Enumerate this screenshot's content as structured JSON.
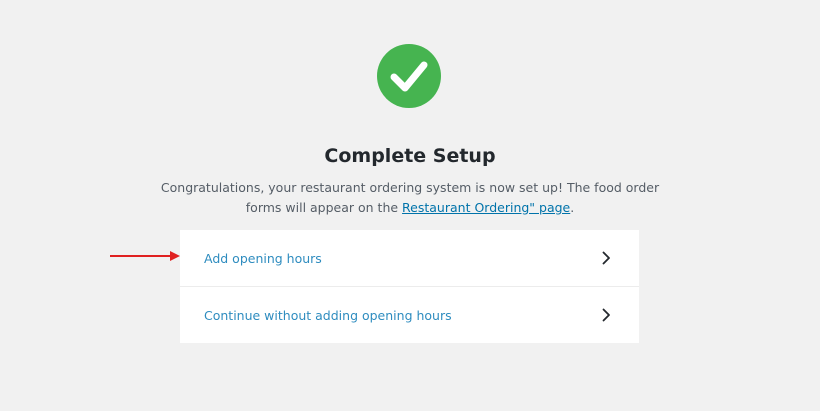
{
  "icons": {
    "success": "check-circle-icon",
    "option_arrow": "chevron-right-icon",
    "pointer": "red-arrow-icon"
  },
  "colors": {
    "success_green": "#46b450",
    "link_blue": "#2e8cbf",
    "annotation_red": "#e02020"
  },
  "setup": {
    "title": "Complete Setup",
    "description_prefix": "Congratulations, your restaurant ordering system is now set up! The food order forms will appear on the ",
    "description_link": "Restaurant Ordering\" page",
    "description_suffix": "."
  },
  "options": [
    {
      "label": "Add opening hours"
    },
    {
      "label": "Continue without adding opening hours"
    }
  ]
}
